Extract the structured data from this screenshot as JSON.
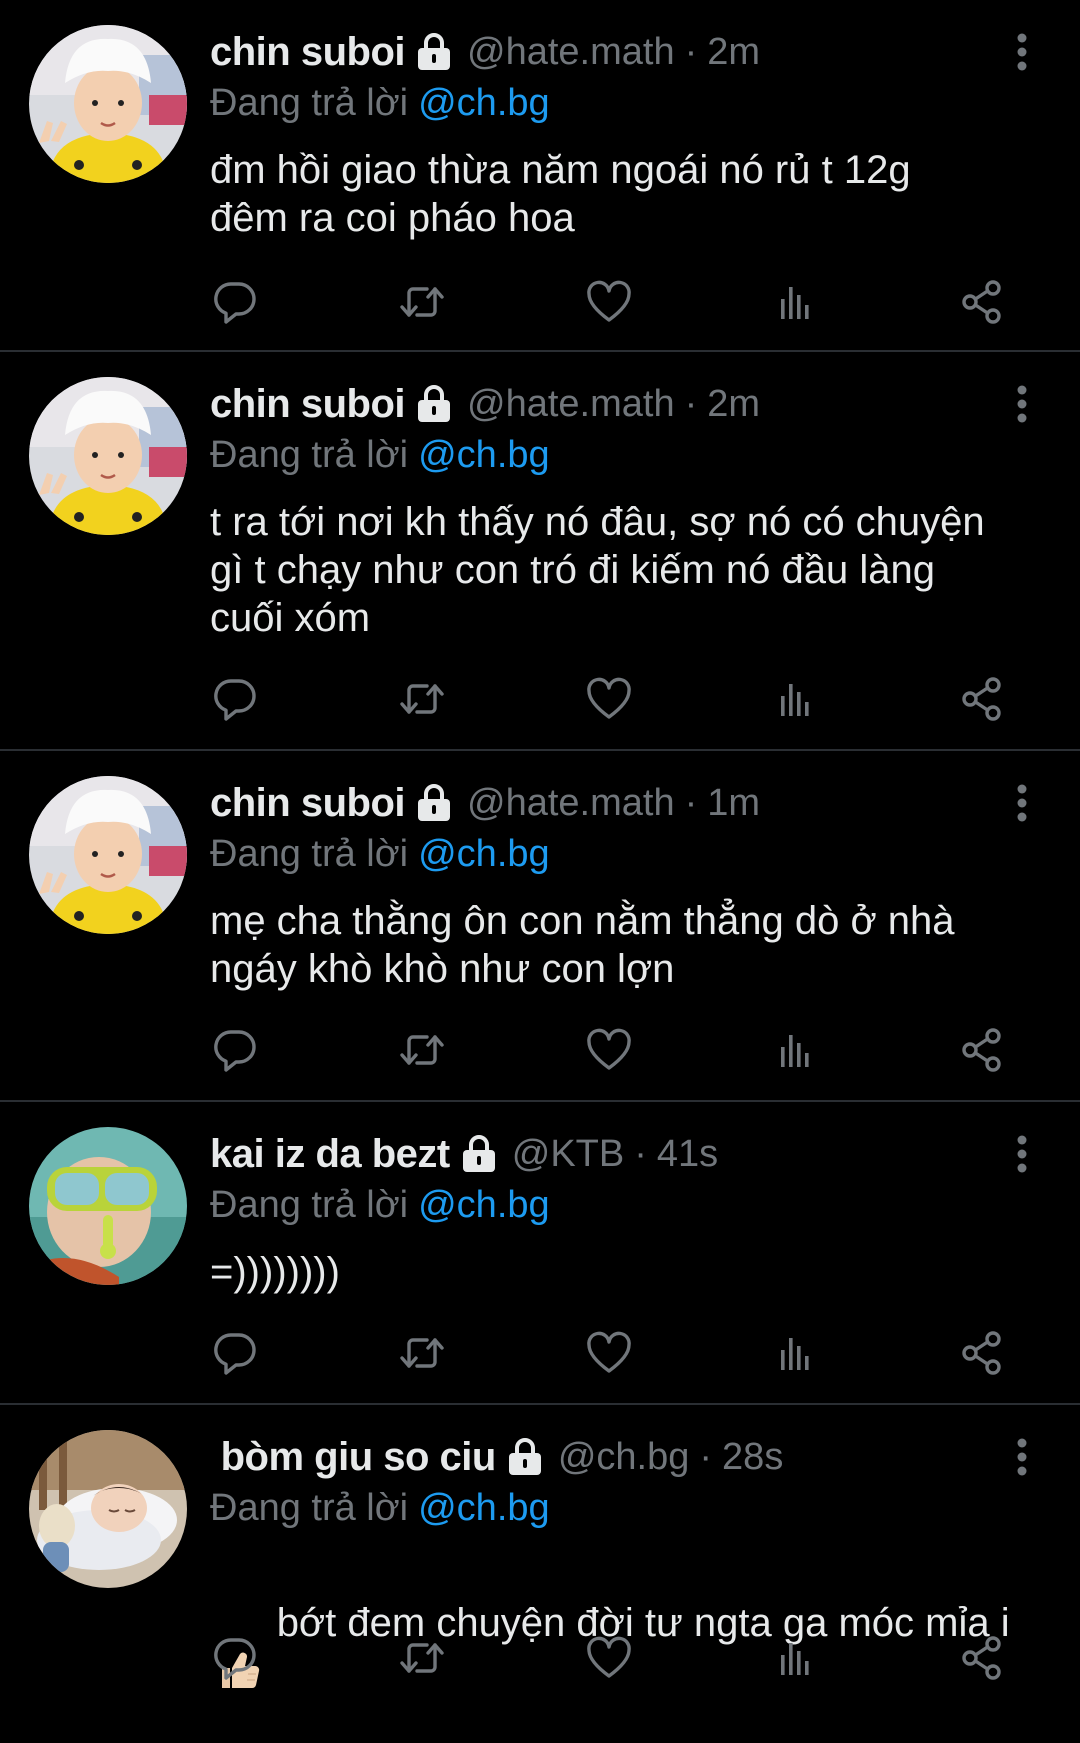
{
  "colors": {
    "background": "#000000",
    "text": "#e7e9ea",
    "muted": "#71767b",
    "mention": "#1d9bf0",
    "divider": "#2a2e33"
  },
  "icons": {
    "lock": "lock-icon",
    "more": "more-vertical-icon",
    "reply": "reply-icon",
    "retweet": "retweet-icon",
    "like": "heart-icon",
    "views": "views-icon",
    "share": "share-icon"
  },
  "tweets": [
    {
      "name": "chin suboi",
      "handle": "@hate.math",
      "separator": "·",
      "time": "2m",
      "reply_prefix": "Đang trả lời",
      "reply_to": "@ch.bg",
      "text": "đm hồi giao thừa năm ngoái nó rủ t 12g\nđêm ra coi pháo hoa"
    },
    {
      "name": "chin suboi",
      "handle": "@hate.math",
      "separator": "·",
      "time": "2m",
      "reply_prefix": "Đang trả lời",
      "reply_to": "@ch.bg",
      "text": "t ra tới nơi kh thấy nó đâu, sợ nó có chuyện\ngì t chạy như con tró đi kiếm nó đầu làng\ncuối xóm"
    },
    {
      "name": "chin suboi",
      "handle": "@hate.math",
      "separator": "·",
      "time": "1m",
      "reply_prefix": "Đang trả lời",
      "reply_to": "@ch.bg",
      "text": "mẹ cha thằng ôn con nằm thẳng dò ở nhà\nngáy khò khò như con lợn"
    },
    {
      "name": "kai iz da bezt",
      "handle": "@KTB",
      "separator": "·",
      "time": "41s",
      "reply_prefix": "Đang trả lời",
      "reply_to": "@ch.bg",
      "text": "=))))))))"
    },
    {
      "name": " bòm giu so ciu",
      "handle": "@ch.bg",
      "separator": "·",
      "time": "28s",
      "reply_prefix": "Đang trả lời",
      "reply_to": "@ch.bg",
      "text": "bớt đem chuyện đời tư ngta ga móc mỉa i",
      "emoji": "thumbs-up-icon"
    }
  ]
}
